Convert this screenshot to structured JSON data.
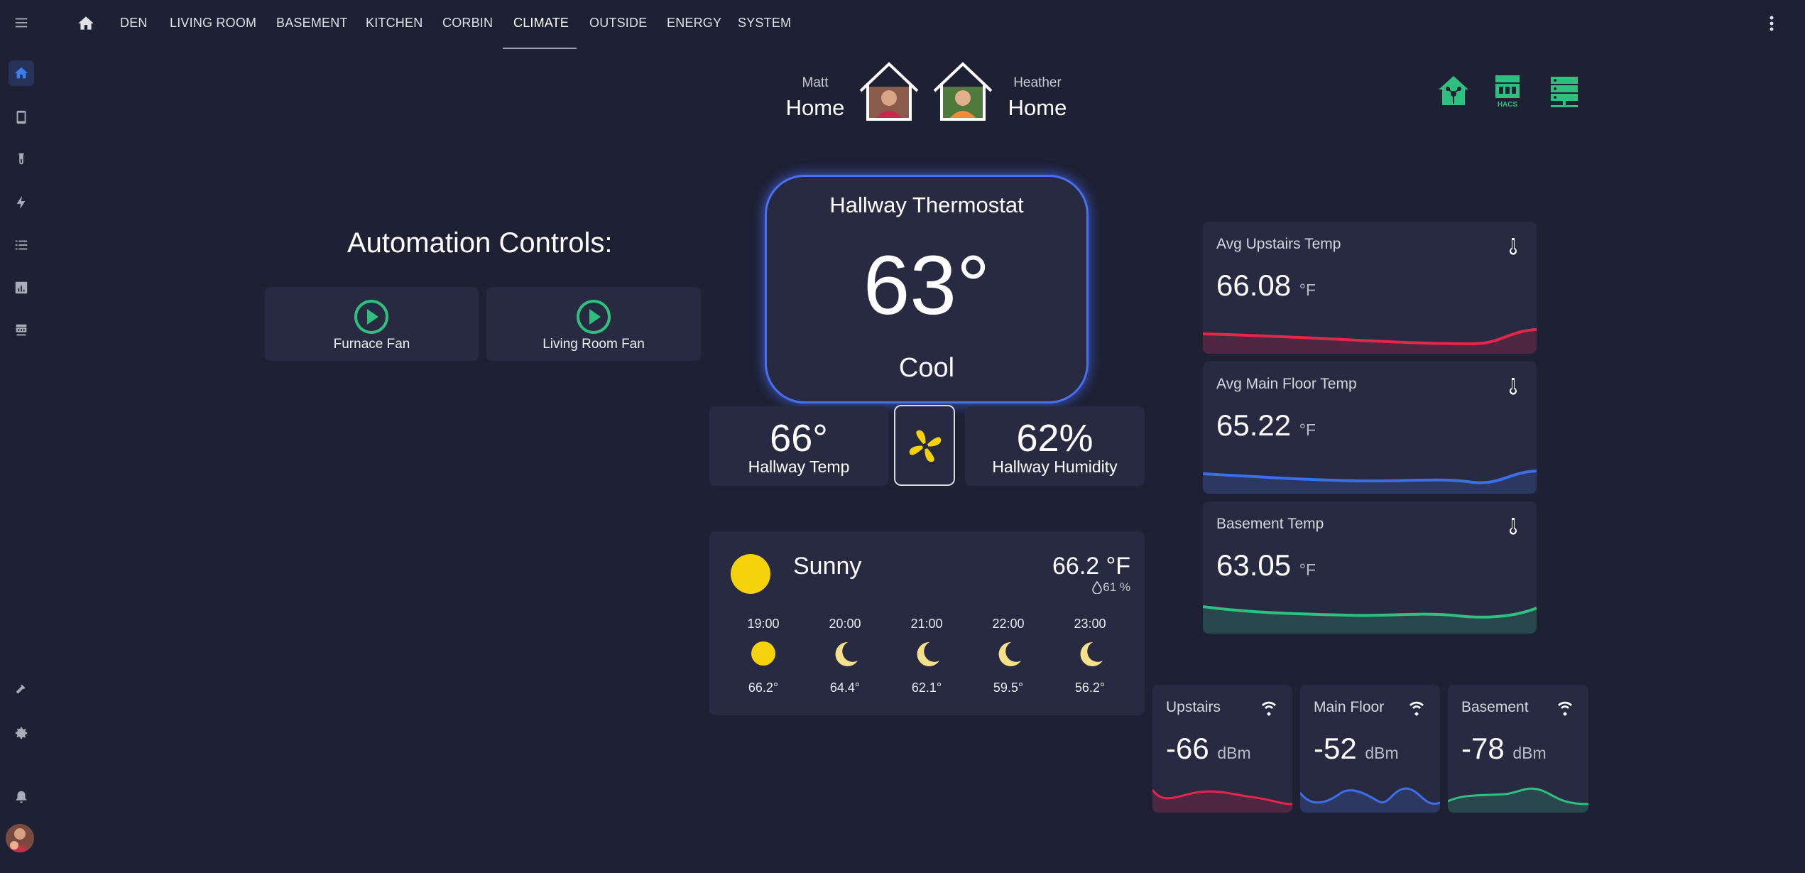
{
  "nav": {
    "tabs": [
      {
        "label": "DEN"
      },
      {
        "label": "LIVING ROOM"
      },
      {
        "label": "BASEMENT"
      },
      {
        "label": "KITCHEN"
      },
      {
        "label": "CORBIN"
      },
      {
        "label": "CLIMATE"
      },
      {
        "label": "OUTSIDE"
      },
      {
        "label": "ENERGY"
      },
      {
        "label": "SYSTEM"
      }
    ],
    "active_tab": "CLIMATE"
  },
  "sidebar": {
    "items": [
      "home-icon",
      "mobile-icon",
      "flask-icon",
      "flash-icon",
      "list-icon",
      "chart-icon",
      "hacs-icon"
    ],
    "bottom": [
      "hammer-icon",
      "gear-icon",
      "bell-icon",
      "avatar"
    ]
  },
  "people": [
    {
      "name": "Matt",
      "state": "Home"
    },
    {
      "name": "Heather",
      "state": "Home"
    }
  ],
  "quick_icons": {
    "hacs_label": "HACS"
  },
  "automation": {
    "title": "Automation Controls:",
    "buttons": [
      {
        "label": "Furnace Fan"
      },
      {
        "label": "Living Room Fan"
      }
    ]
  },
  "thermostat": {
    "name": "Hallway Thermostat",
    "temp": "63°",
    "mode": "Cool"
  },
  "hallway": {
    "temp_value": "66°",
    "temp_label": "Hallway Temp",
    "humidity_value": "62%",
    "humidity_label": "Hallway Humidity"
  },
  "weather": {
    "condition": "Sunny",
    "temp": "66.2 °F",
    "humidity": "61 %",
    "forecast": [
      {
        "time": "19:00",
        "temp": "66.2°",
        "icon": "sun-icon"
      },
      {
        "time": "20:00",
        "temp": "64.4°",
        "icon": "moon-icon"
      },
      {
        "time": "21:00",
        "temp": "62.1°",
        "icon": "moon-icon"
      },
      {
        "time": "22:00",
        "temp": "59.5°",
        "icon": "moon-icon"
      },
      {
        "time": "23:00",
        "temp": "56.2°",
        "icon": "moon-icon"
      }
    ]
  },
  "sensors": [
    {
      "title": "Avg Upstairs Temp",
      "value": "66.08",
      "unit": "°F",
      "color": "#e5254a"
    },
    {
      "title": "Avg Main Floor Temp",
      "value": "65.22",
      "unit": "°F",
      "color": "#3b6fe8"
    },
    {
      "title": "Basement Temp",
      "value": "63.05",
      "unit": "°F",
      "color": "#2fbf7e"
    }
  ],
  "wifi": [
    {
      "title": "Upstairs",
      "value": "-66",
      "unit": "dBm",
      "color": "#e5254a"
    },
    {
      "title": "Main Floor",
      "value": "-52",
      "unit": "dBm",
      "color": "#3b6fe8"
    },
    {
      "title": "Basement",
      "value": "-78",
      "unit": "dBm",
      "color": "#2fbf7e"
    }
  ],
  "colors": {
    "accent": "#3d7df2",
    "quick_icon_green": "#2fbf7e",
    "play_green": "#2fbf7e",
    "fan_yellow": "#f5d20b",
    "sun_yellow": "#f5d20b"
  }
}
